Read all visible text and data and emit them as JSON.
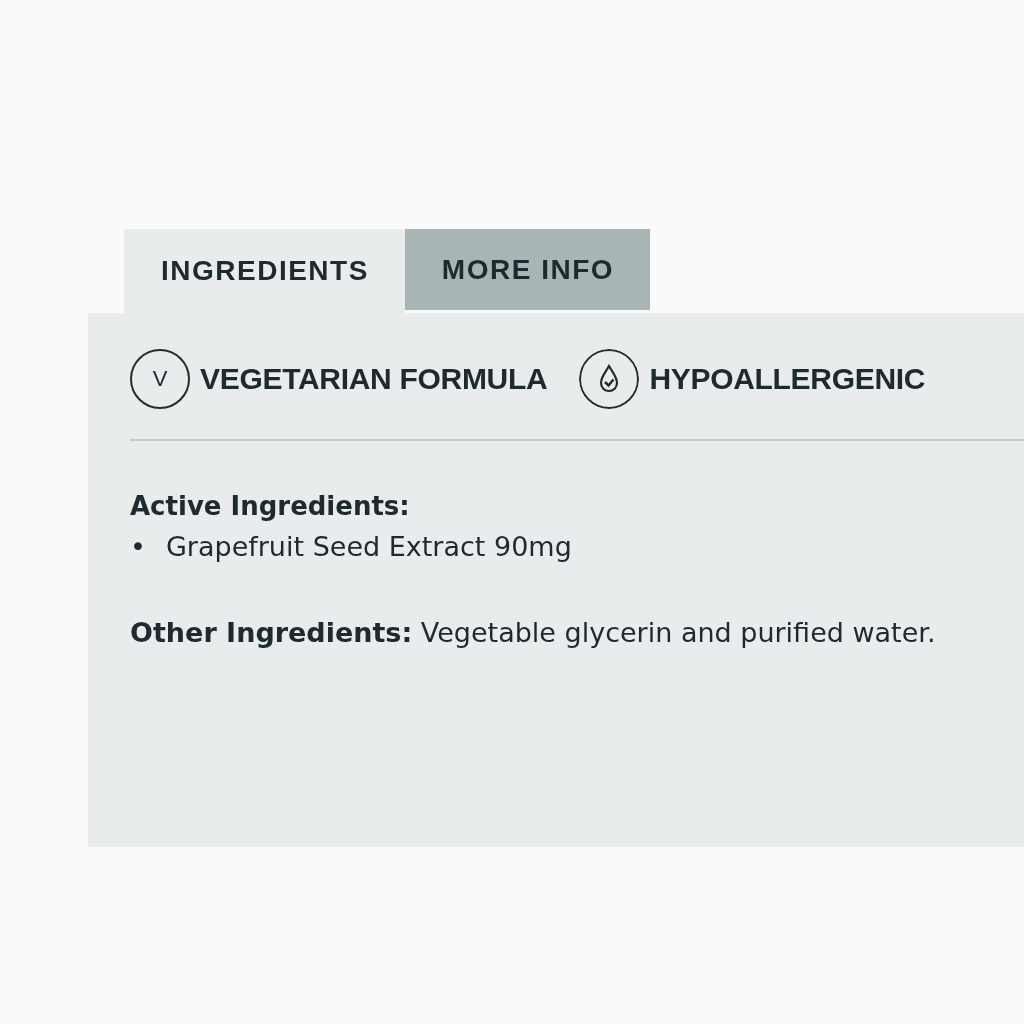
{
  "tabs": [
    {
      "label": "INGREDIENTS",
      "selected": true
    },
    {
      "label": "MORE INFO",
      "selected": false
    }
  ],
  "badges": [
    {
      "kind": "letter",
      "icon_text": "V",
      "label": "VEGETARIAN FORMULA"
    },
    {
      "kind": "drop",
      "label": "HYPOALLERGENIC"
    }
  ],
  "active_ingredients": {
    "heading": "Active Ingredients:",
    "items": [
      {
        "bullet": "•",
        "text": "Grapefruit Seed Extract 90mg"
      }
    ]
  },
  "other_ingredients": "**Other Ingredients:** Vegetable glycerin and purified water."
}
